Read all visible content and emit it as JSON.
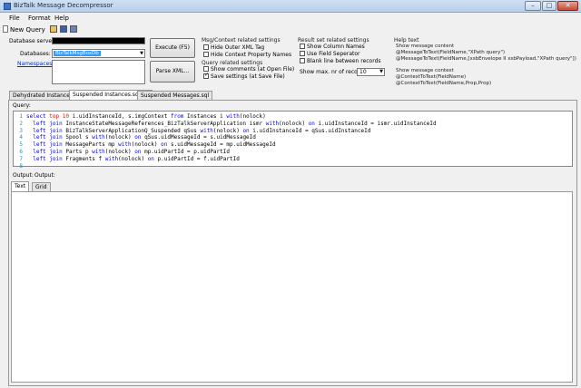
{
  "window": {
    "title": "BizTalk Message Decompressor"
  },
  "menu": [
    "File",
    "Format",
    "Help"
  ],
  "toolbar": {
    "new_query": "New Query"
  },
  "config": {
    "server_label": "Database server:",
    "database_label": "Databases:",
    "database_value": "BizTalkMsgBoxDb",
    "namespaces_label": "Namespaces:",
    "execute_label": "Execute (F5)",
    "parse_label": "Parse XML..."
  },
  "msg_context": {
    "title": "Msg/Context related settings",
    "options": [
      {
        "label": "Hide Outer XML Tag",
        "checked": false
      },
      {
        "label": "Hide Context Property Names",
        "checked": false
      }
    ]
  },
  "query_settings": {
    "title": "Query related settings",
    "options": [
      {
        "label": "Show comments (at Open File)",
        "checked": false
      },
      {
        "label": "Save settings (at Save File)",
        "checked": true
      }
    ]
  },
  "result_settings": {
    "title": "Result set related settings",
    "options": [
      {
        "label": "Show Column Names",
        "checked": false
      },
      {
        "label": "Use Field Seperator",
        "checked": false
      },
      {
        "label": "Blank line between records",
        "checked": false
      }
    ],
    "max_records_label": "Show max. nr of records:",
    "max_records_value": "10"
  },
  "help": {
    "title": "Help text",
    "lines": [
      "Show message content",
      "@MessageToText(FieldName,\"XPath query\")",
      "@MessageToText(FieldName,[xsbEnvelope II xsbPayload,\"XPath query\"])",
      "",
      "Show message context",
      "@ContextToText(FieldName)",
      "@ContextToText(FieldName,Prop,Prop)"
    ]
  },
  "tabs": [
    {
      "label": "Dehydrated Instance.sql",
      "active": false
    },
    {
      "label": "Suspended Instances.sql (*)",
      "active": true
    },
    {
      "label": "Suspended Messages.sql",
      "active": false
    }
  ],
  "query_label": "Query:",
  "code_lines": [
    [
      [
        "kw",
        "select "
      ],
      [
        "num",
        "top 10 "
      ],
      [
        "t",
        "i.uidInstanceId, s.imgContext "
      ],
      [
        "kw",
        "from "
      ],
      [
        "t",
        "Instances i "
      ],
      [
        "kw",
        "with"
      ],
      [
        "t",
        "(nolock)"
      ]
    ],
    [
      [
        "kw",
        "  left join "
      ],
      [
        "t",
        "InstanceStateMessageReferences_BizTalkServerApplication ismr "
      ],
      [
        "kw",
        "with"
      ],
      [
        "t",
        "(nolock) "
      ],
      [
        "kw",
        "on "
      ],
      [
        "t",
        "i.uidInstanceId = ismr.uidInstanceId"
      ]
    ],
    [
      [
        "kw",
        "  left join "
      ],
      [
        "t",
        "BizTalkServerApplicationQ_Suspended qSus "
      ],
      [
        "kw",
        "with"
      ],
      [
        "t",
        "(nolock) "
      ],
      [
        "kw",
        "on "
      ],
      [
        "t",
        "i.uidInstanceId = qSus.uidInstanceId"
      ]
    ],
    [
      [
        "kw",
        "  left join "
      ],
      [
        "t",
        "Spool s "
      ],
      [
        "kw",
        "with"
      ],
      [
        "t",
        "(nolock) "
      ],
      [
        "kw",
        "on "
      ],
      [
        "t",
        "qSus.uidMessageId = s.uidMessageId"
      ]
    ],
    [
      [
        "kw",
        "  left join "
      ],
      [
        "t",
        "MessageParts mp "
      ],
      [
        "kw",
        "with"
      ],
      [
        "t",
        "(nolock) "
      ],
      [
        "kw",
        "on "
      ],
      [
        "t",
        "s.uidMessageId = mp.uidMessageId"
      ]
    ],
    [
      [
        "kw",
        "  left join "
      ],
      [
        "t",
        "Parts p "
      ],
      [
        "kw",
        "with"
      ],
      [
        "t",
        "(nolock) "
      ],
      [
        "kw",
        "on "
      ],
      [
        "t",
        "mp.uidPartId = p.uidPartId"
      ]
    ],
    [
      [
        "kw",
        "  left join "
      ],
      [
        "t",
        "Fragments f "
      ],
      [
        "kw",
        "with"
      ],
      [
        "t",
        "(nolock) "
      ],
      [
        "kw",
        "on "
      ],
      [
        "t",
        "p.uidPartId = f.uidPartId"
      ]
    ],
    []
  ],
  "output": {
    "label1": "Output:",
    "label2": "Output:",
    "tabs": [
      {
        "label": "Text",
        "active": true
      },
      {
        "label": "Grid",
        "active": false
      }
    ]
  }
}
